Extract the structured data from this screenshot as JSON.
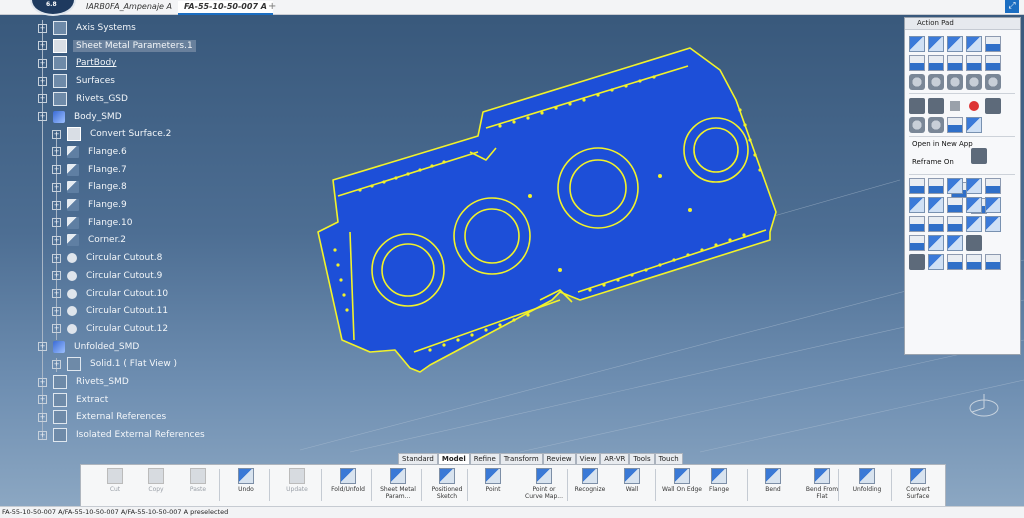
{
  "tabs": [
    {
      "label": "IARB0FA_Ampenaje A"
    },
    {
      "label": "FA-55-10-50-007 A"
    }
  ],
  "logo_text": "6.8",
  "tree": [
    {
      "label": "Axis Systems",
      "icon": "axis-system-icon",
      "indent": 0
    },
    {
      "label": "Sheet Metal Parameters.1",
      "icon": "sheet-metal-params-icon",
      "indent": 0
    },
    {
      "label": "PartBody",
      "icon": "partbody-icon",
      "indent": 0
    },
    {
      "label": "Surfaces",
      "icon": "surfaces-icon",
      "indent": 0
    },
    {
      "label": "Rivets_GSD",
      "icon": "geometric-set-icon",
      "indent": 0
    },
    {
      "label": "Body_SMD",
      "icon": "body-icon",
      "indent": 0
    },
    {
      "label": "Convert Surface.2",
      "icon": "convert-surface-icon",
      "indent": 1
    },
    {
      "label": "Flange.6",
      "icon": "flange-icon",
      "indent": 1
    },
    {
      "label": "Flange.7",
      "icon": "flange-icon",
      "indent": 1
    },
    {
      "label": "Flange.8",
      "icon": "flange-icon",
      "indent": 1
    },
    {
      "label": "Flange.9",
      "icon": "flange-icon",
      "indent": 1
    },
    {
      "label": "Flange.10",
      "icon": "flange-icon",
      "indent": 1
    },
    {
      "label": "Corner.2",
      "icon": "corner-icon",
      "indent": 1
    },
    {
      "label": "Circular Cutout.8",
      "icon": "circular-cutout-icon",
      "indent": 1
    },
    {
      "label": "Circular Cutout.9",
      "icon": "circular-cutout-icon",
      "indent": 1
    },
    {
      "label": "Circular Cutout.10",
      "icon": "circular-cutout-icon",
      "indent": 1
    },
    {
      "label": "Circular Cutout.11",
      "icon": "circular-cutout-icon",
      "indent": 1
    },
    {
      "label": "Circular Cutout.12",
      "icon": "circular-cutout-icon",
      "indent": 1
    },
    {
      "label": "Unfolded_SMD",
      "icon": "body-icon",
      "indent": 0
    },
    {
      "label": "Solid.1 ( Flat View )",
      "icon": "solid-icon",
      "indent": 1
    },
    {
      "label": "Rivets_SMD",
      "icon": "geometric-set-icon",
      "indent": 0
    },
    {
      "label": "Extract",
      "icon": "geometric-set-icon",
      "indent": 0
    },
    {
      "label": "External References",
      "icon": "external-references-icon",
      "indent": 0
    },
    {
      "label": "Isolated External References",
      "icon": "external-references-icon",
      "indent": 0
    }
  ],
  "action_pad": {
    "title": "Action Pad",
    "open_in_new_app": "Open in New App",
    "reframe_on": "Reframe On"
  },
  "context_tabs": [
    "Standard",
    "Model",
    "Refine",
    "Transform",
    "Review",
    "View",
    "AR-VR",
    "Tools",
    "Touch"
  ],
  "active_context_tab": "Model",
  "toolbar": [
    {
      "label": "Cut",
      "enabled": false
    },
    {
      "label": "Copy",
      "enabled": false
    },
    {
      "label": "Paste",
      "enabled": false
    },
    {
      "label": "Undo",
      "enabled": true
    },
    {
      "label": "Update",
      "enabled": false
    },
    {
      "label": "Fold/Unfold",
      "enabled": true
    },
    {
      "label": "Sheet Metal Param...",
      "enabled": true
    },
    {
      "label": "Positioned Sketch",
      "enabled": true
    },
    {
      "label": "Point",
      "enabled": true
    },
    {
      "label": "Point or Curve Map...",
      "enabled": true
    },
    {
      "label": "Recognize",
      "enabled": true
    },
    {
      "label": "Wall",
      "enabled": true
    },
    {
      "label": "Wall On Edge",
      "enabled": true
    },
    {
      "label": "Flange",
      "enabled": true
    },
    {
      "label": "Bend",
      "enabled": true
    },
    {
      "label": "Bend From Flat",
      "enabled": true
    },
    {
      "label": "Unfolding",
      "enabled": true
    },
    {
      "label": "Convert Surface",
      "enabled": true
    }
  ],
  "status_text": "FA-55-10-50-007 A/FA-55-10-50-007 A/FA-55-10-50-007 A preselected",
  "colors": {
    "part_fill": "#1d4fd8",
    "part_edge": "#f2f22a",
    "bg_top": "#37577a",
    "bg_bottom": "#8ea9c4"
  }
}
